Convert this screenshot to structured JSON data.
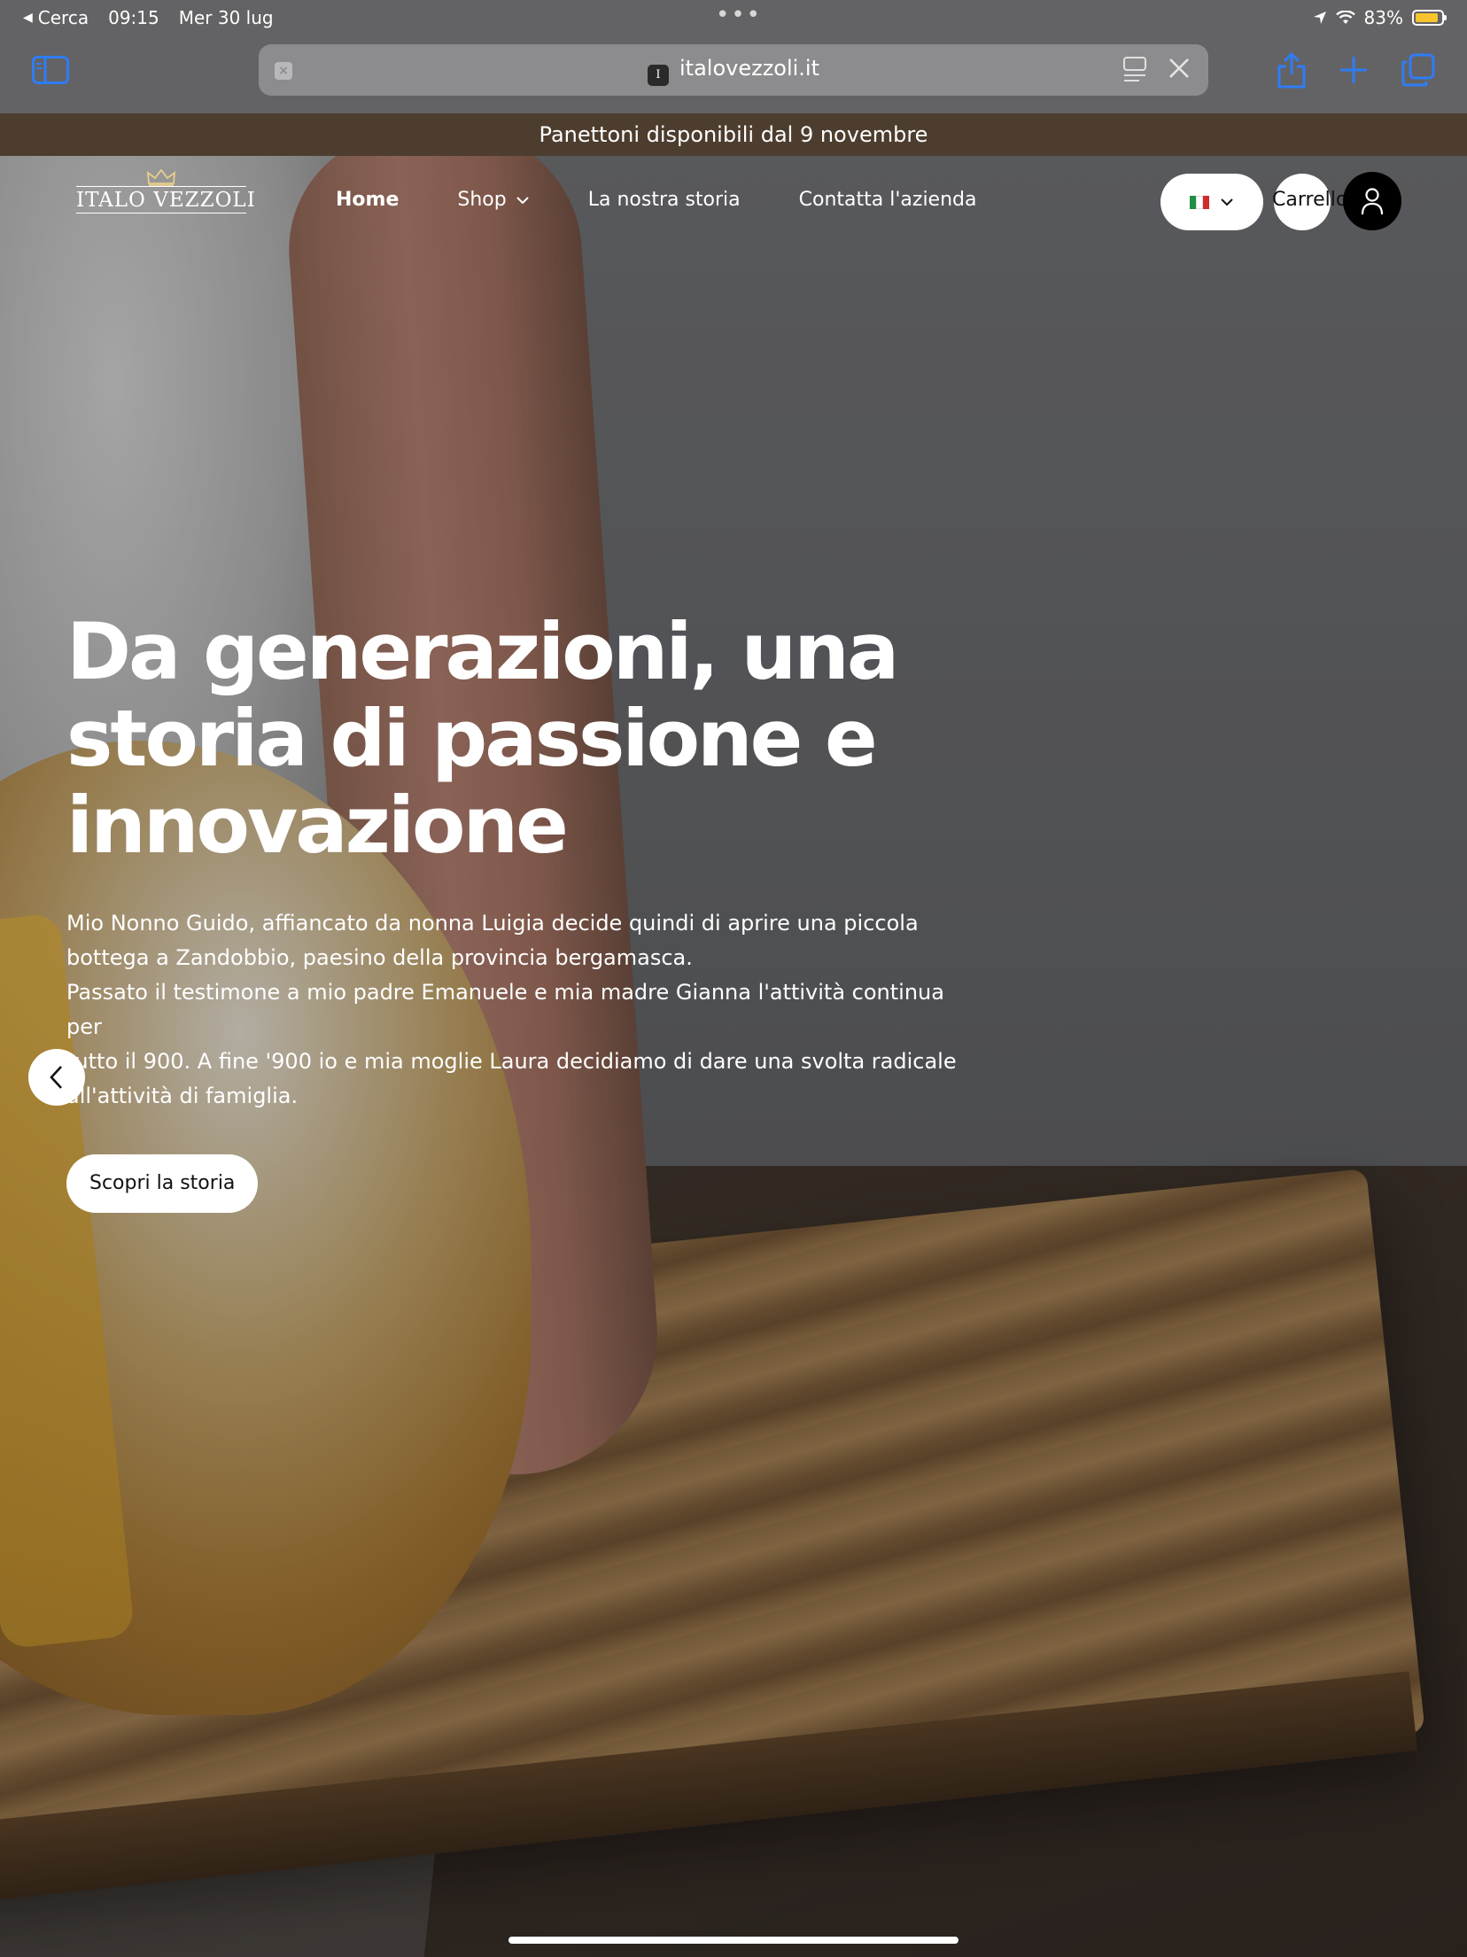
{
  "status_bar": {
    "back_label": "Cerca",
    "time": "09:15",
    "date": "Mer 30 lug",
    "battery": "83%",
    "battery_level": 0.83,
    "battery_color": "#f6c42c"
  },
  "browser": {
    "url": "italovezzoli.it",
    "favicon_letter": "I",
    "icons": [
      "sidebar-icon",
      "tab-close-icon",
      "reader-icon",
      "close-icon",
      "share-icon",
      "new-tab-icon",
      "tabs-overview-icon"
    ],
    "accent": "#2f7cf6"
  },
  "announcement": {
    "text": "Panettoni disponibili dal 9 novembre",
    "bg": "#4d3d2e"
  },
  "header": {
    "logo_text": "ITALO VEZZOLI",
    "nav": [
      {
        "label": "Home",
        "active": true
      },
      {
        "label": "Shop",
        "has_dropdown": true
      },
      {
        "label": "La nostra storia"
      },
      {
        "label": "Contatta l'azienda"
      }
    ],
    "language_icon": "italy-flag-icon",
    "cart_label": "Carrello",
    "account_icon": "user-icon"
  },
  "hero": {
    "title": "Da generazioni, una storia di passione e innovazione",
    "paragraph_lines": [
      "Mio Nonno Guido, affiancato da nonna Luigia decide quindi di aprire una piccola",
      "bottega a Zandobbio, paesino della provincia bergamasca.",
      "Passato il testimone a mio padre Emanuele e mia madre Gianna l'attività continua",
      "per",
      "tutto il 900. A fine '900 io e mia moglie Laura decidiamo di dare una svolta radicale",
      "all'attività di famiglia."
    ],
    "cta_label": "Scopri la storia",
    "prev_icon": "chevron-left-icon"
  }
}
